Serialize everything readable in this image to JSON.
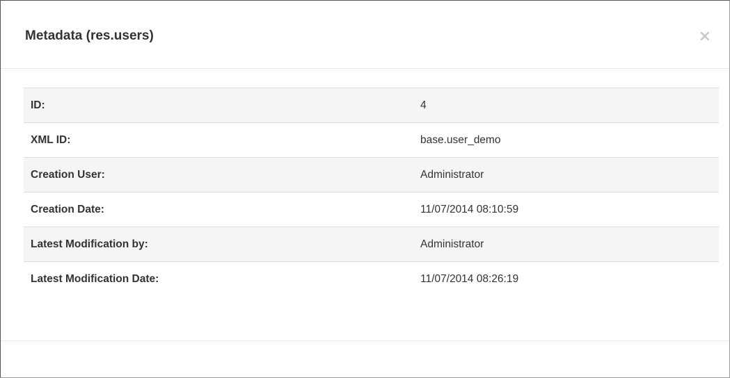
{
  "dialog": {
    "title": "Metadata (res.users)",
    "close_label": "×"
  },
  "rows": [
    {
      "label": "ID:",
      "value": "4"
    },
    {
      "label": "XML ID:",
      "value": "base.user_demo"
    },
    {
      "label": "Creation User:",
      "value": "Administrator"
    },
    {
      "label": "Creation Date:",
      "value": "11/07/2014 08:10:59"
    },
    {
      "label": "Latest Modification by:",
      "value": "Administrator"
    },
    {
      "label": "Latest Modification Date:",
      "value": "11/07/2014 08:26:19"
    }
  ]
}
